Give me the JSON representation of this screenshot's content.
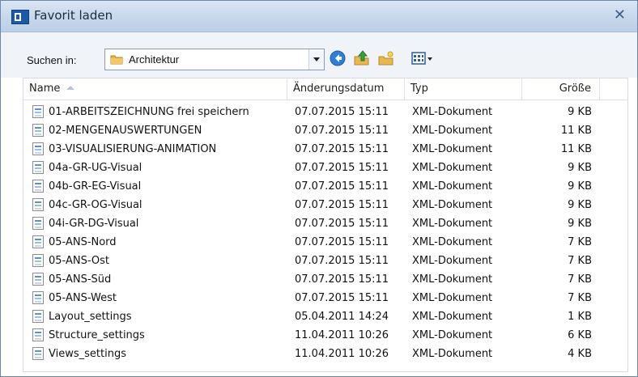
{
  "window": {
    "title": "Favorit laden",
    "close_icon": "close-icon"
  },
  "toolbar": {
    "search_label": "Suchen in:",
    "folder": "Architektur",
    "icons": [
      "back-icon",
      "up-folder-icon",
      "new-folder-icon",
      "view-menu-icon"
    ]
  },
  "columns": {
    "name": "Name",
    "date": "Änderungsdatum",
    "type": "Typ",
    "size": "Größe"
  },
  "files": [
    {
      "name": "01-ARBEITSZEICHNUNG frei speichern",
      "date": "07.07.2015 15:11",
      "type": "XML-Dokument",
      "size": "9 KB"
    },
    {
      "name": "02-MENGENAUSWERTUNGEN",
      "date": "07.07.2015 15:11",
      "type": "XML-Dokument",
      "size": "11 KB"
    },
    {
      "name": "03-VISUALISIERUNG-ANIMATION",
      "date": "07.07.2015 15:11",
      "type": "XML-Dokument",
      "size": "11 KB"
    },
    {
      "name": "04a-GR-UG-Visual",
      "date": "07.07.2015 15:11",
      "type": "XML-Dokument",
      "size": "9 KB"
    },
    {
      "name": "04b-GR-EG-Visual",
      "date": "07.07.2015 15:11",
      "type": "XML-Dokument",
      "size": "9 KB"
    },
    {
      "name": "04c-GR-OG-Visual",
      "date": "07.07.2015 15:11",
      "type": "XML-Dokument",
      "size": "9 KB"
    },
    {
      "name": "04i-GR-DG-Visual",
      "date": "07.07.2015 15:11",
      "type": "XML-Dokument",
      "size": "9 KB"
    },
    {
      "name": "05-ANS-Nord",
      "date": "07.07.2015 15:11",
      "type": "XML-Dokument",
      "size": "7 KB"
    },
    {
      "name": "05-ANS-Ost",
      "date": "07.07.2015 15:11",
      "type": "XML-Dokument",
      "size": "7 KB"
    },
    {
      "name": "05-ANS-Süd",
      "date": "07.07.2015 15:11",
      "type": "XML-Dokument",
      "size": "7 KB"
    },
    {
      "name": "05-ANS-West",
      "date": "07.07.2015 15:11",
      "type": "XML-Dokument",
      "size": "7 KB"
    },
    {
      "name": "Layout_settings",
      "date": "05.04.2011 14:24",
      "type": "XML-Dokument",
      "size": "1 KB"
    },
    {
      "name": "Structure_settings",
      "date": "11.04.2011 10:26",
      "type": "XML-Dokument",
      "size": "6 KB"
    },
    {
      "name": "Views_settings",
      "date": "11.04.2011 10:26",
      "type": "XML-Dokument",
      "size": "4 KB"
    }
  ]
}
